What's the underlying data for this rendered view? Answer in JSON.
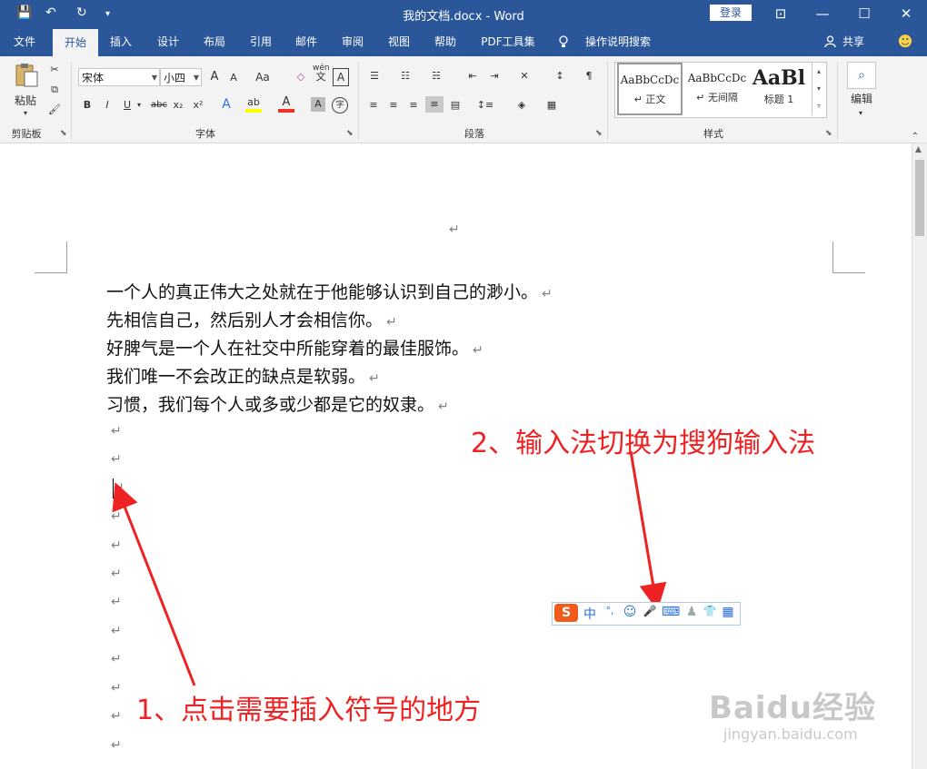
{
  "titlebar": {
    "title": "我的文档.docx  -  Word",
    "login_label": "登录",
    "qa_save": "💾",
    "qa_undo": "↶",
    "qa_redo": "↻",
    "qa_more": "▾",
    "ribbon_display": "⊡",
    "minimize": "—",
    "maximize": "☐",
    "close": "✕"
  },
  "tabs": [
    "文件",
    "开始",
    "插入",
    "设计",
    "布局",
    "引用",
    "邮件",
    "审阅",
    "视图",
    "帮助",
    "PDF工具集",
    "操作说明搜索"
  ],
  "share_label": "共享",
  "ribbon": {
    "clipboard": {
      "paste_label": "粘贴",
      "group_label": "剪贴板"
    },
    "font": {
      "font_name": "宋体",
      "font_size": "小四",
      "group_label": "字体",
      "grow": "A",
      "shrink": "A",
      "change_case": "Aa",
      "bold": "B",
      "italic": "I",
      "underline": "U",
      "strikethrough": "abc",
      "subscript": "x₂",
      "superscript": "x²",
      "phonetic": "wén",
      "phonetic_sub": "文"
    },
    "paragraph": {
      "group_label": "段落"
    },
    "styles": {
      "group_label": "样式",
      "items": [
        {
          "preview": "AaBbCcDc",
          "name": "↵ 正文"
        },
        {
          "preview": "AaBbCcDc",
          "name": "↵ 无间隔"
        },
        {
          "preview": "AaBl",
          "name": "标题 1"
        }
      ]
    },
    "editing": {
      "label": "编辑"
    }
  },
  "document": {
    "header_mark": "↵",
    "lines": [
      "一个人的真正伟大之处就在于他能够认识到自己的渺小。",
      "先相信自己，然后别人才会相信你。",
      "好脾气是一个人在社交中所能穿着的最佳服饰。",
      "我们唯一不会改正的缺点是软弱。",
      "习惯，我们每个人或多或少都是它的奴隶。"
    ],
    "para_mark": "↵"
  },
  "annotations": {
    "step1": "1、点击需要插入符号的地方",
    "step2": "2、输入法切换为搜狗输入法",
    "arrow_color": "#ee2222"
  },
  "ime": {
    "logo": "S",
    "mode": "中",
    "punct": "°,",
    "emoji": "☺",
    "voice": "🎤",
    "keyboard": "⌨",
    "skin": "👕",
    "tools": "▦"
  },
  "watermark": {
    "brand": "Baidu经验",
    "url": "jingyan.baidu.com"
  },
  "colors": {
    "accent": "#2b579a",
    "annotation": "#ee2222",
    "ime_logo": "#f05a1a"
  }
}
